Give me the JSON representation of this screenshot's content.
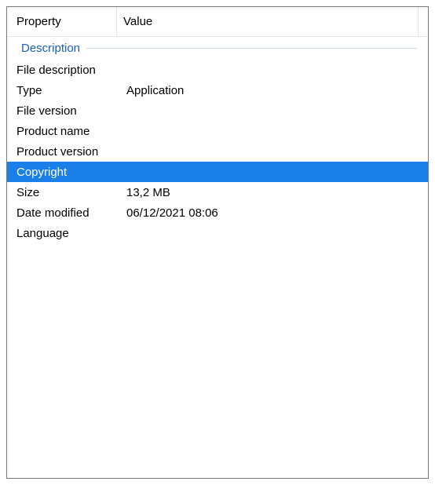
{
  "columns": {
    "property": "Property",
    "value": "Value"
  },
  "group": {
    "title": "Description"
  },
  "rows": [
    {
      "name": "file-description",
      "property": "File description",
      "value": "",
      "selected": false
    },
    {
      "name": "type",
      "property": "Type",
      "value": "Application",
      "selected": false
    },
    {
      "name": "file-version",
      "property": "File version",
      "value": "",
      "selected": false
    },
    {
      "name": "product-name",
      "property": "Product name",
      "value": "",
      "selected": false
    },
    {
      "name": "product-version",
      "property": "Product version",
      "value": "",
      "selected": false
    },
    {
      "name": "copyright",
      "property": "Copyright",
      "value": "",
      "selected": true
    },
    {
      "name": "size",
      "property": "Size",
      "value": "13,2 MB",
      "selected": false
    },
    {
      "name": "date-modified",
      "property": "Date modified",
      "value": "06/12/2021 08:06",
      "selected": false
    },
    {
      "name": "language",
      "property": "Language",
      "value": "",
      "selected": false
    }
  ],
  "colors": {
    "selection": "#1a7fe8",
    "group_text": "#1a5fb4"
  }
}
